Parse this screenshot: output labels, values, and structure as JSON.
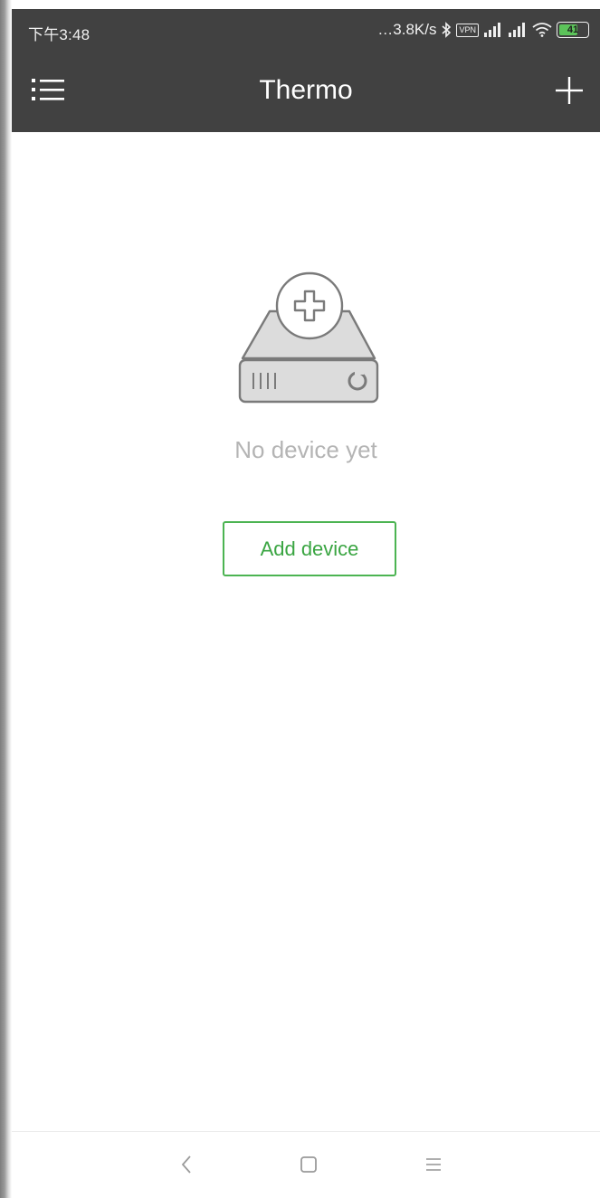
{
  "status_bar": {
    "time": "下午3:48",
    "network_speed": "…3.8K/s",
    "vpn_label": "VPN",
    "battery_level": "41",
    "icons": [
      "bluetooth-icon",
      "vpn-icon",
      "signal-icon",
      "signal-icon",
      "wifi-icon",
      "battery-icon"
    ]
  },
  "app_bar": {
    "title": "Thermo",
    "menu_icon": "list-menu-icon",
    "add_icon": "plus-icon"
  },
  "empty_state": {
    "icon": "device-add-icon",
    "message": "No device yet",
    "button_label": "Add device"
  },
  "nav_bar": {
    "icons": [
      "back-icon",
      "home-icon",
      "recent-apps-icon"
    ]
  },
  "colors": {
    "app_bar": "#414141",
    "accent_green": "#4cb452",
    "muted_text": "#b4b4b4",
    "illustration_stroke": "#7a7a7a",
    "illustration_fill": "#dcdcdc"
  }
}
